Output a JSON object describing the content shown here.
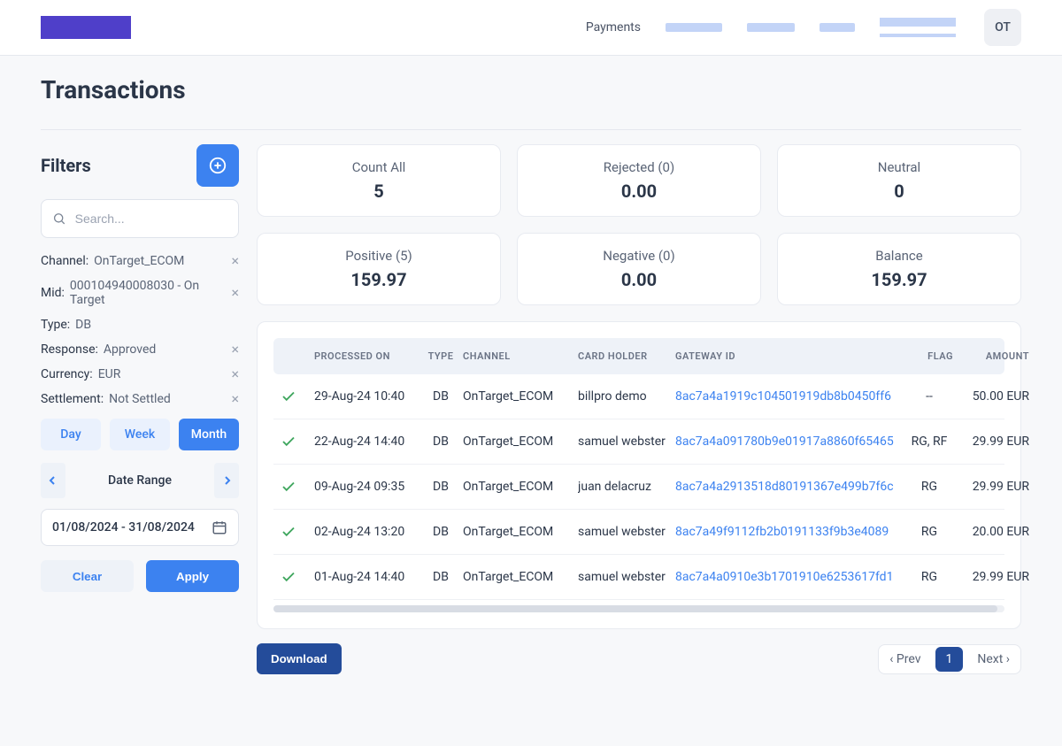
{
  "header": {
    "nav_payments": "Payments",
    "avatar_initials": "OT"
  },
  "page_title": "Transactions",
  "filters": {
    "title": "Filters",
    "search_placeholder": "Search...",
    "chips": [
      {
        "label": "Channel:",
        "value": "OnTarget_ECOM",
        "closable": true
      },
      {
        "label": "Mid:",
        "value": "000104940008030 - On Target",
        "closable": true
      },
      {
        "label": "Type:",
        "value": "DB",
        "closable": false
      },
      {
        "label": "Response:",
        "value": "Approved",
        "closable": true
      },
      {
        "label": "Currency:",
        "value": "EUR",
        "closable": true
      },
      {
        "label": "Settlement:",
        "value": "Not Settled",
        "closable": true
      }
    ],
    "range_tabs": {
      "day": "Day",
      "week": "Week",
      "month": "Month",
      "active": "month"
    },
    "date_range_label": "Date Range",
    "date_range_value": "01/08/2024 - 31/08/2024",
    "clear": "Clear",
    "apply": "Apply"
  },
  "stats": {
    "count_all": {
      "label": "Count All",
      "value": "5"
    },
    "rejected": {
      "label": "Rejected (0)",
      "value": "0.00"
    },
    "neutral": {
      "label": "Neutral",
      "value": "0"
    },
    "positive": {
      "label": "Positive (5)",
      "value": "159.97"
    },
    "negative": {
      "label": "Negative (0)",
      "value": "0.00"
    },
    "balance": {
      "label": "Balance",
      "value": "159.97"
    }
  },
  "table": {
    "headers": {
      "processed_on": "Processed On",
      "type": "Type",
      "channel": "Channel",
      "card_holder": "Card Holder",
      "gateway_id": "Gateway ID",
      "flag": "Flag",
      "amount": "Amount"
    },
    "rows": [
      {
        "processed_on": "29-Aug-24 10:40",
        "type": "DB",
        "channel": "OnTarget_ECOM",
        "card_holder": "billpro demo",
        "gateway_id": "8ac7a4a1919c104501919db8b0450ff6",
        "flag": "--",
        "amount": "50.00 EUR"
      },
      {
        "processed_on": "22-Aug-24 14:40",
        "type": "DB",
        "channel": "OnTarget_ECOM",
        "card_holder": "samuel webster",
        "gateway_id": "8ac7a4a091780b9e01917a8860f65465",
        "flag": "RG, RF",
        "amount": "29.99 EUR"
      },
      {
        "processed_on": "09-Aug-24 09:35",
        "type": "DB",
        "channel": "OnTarget_ECOM",
        "card_holder": "juan delacruz",
        "gateway_id": "8ac7a4a2913518d80191367e499b7f6c",
        "flag": "RG",
        "amount": "29.99 EUR"
      },
      {
        "processed_on": "02-Aug-24 13:20",
        "type": "DB",
        "channel": "OnTarget_ECOM",
        "card_holder": "samuel webster",
        "gateway_id": "8ac7a49f9112fb2b0191133f9b3e4089",
        "flag": "RG",
        "amount": "20.00 EUR"
      },
      {
        "processed_on": "01-Aug-24 14:40",
        "type": "DB",
        "channel": "OnTarget_ECOM",
        "card_holder": "samuel webster",
        "gateway_id": "8ac7a4a0910e3b1701910e6253617fd1",
        "flag": "RG",
        "amount": "29.99 EUR"
      }
    ]
  },
  "footer": {
    "download": "Download",
    "prev": "‹ Prev",
    "page": "1",
    "next": "Next ›"
  }
}
